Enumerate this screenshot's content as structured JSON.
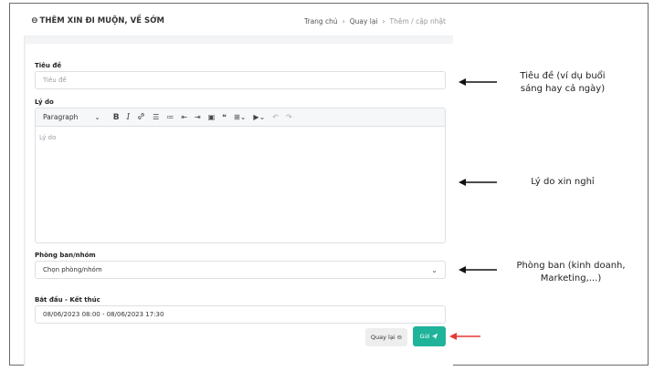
{
  "header": {
    "title": "THÊM XIN ĐI MUỘN, VỀ SỚM",
    "back_icon": "circle-arrow-left-icon",
    "breadcrumb": [
      "Trang chủ",
      "Quay lại",
      "Thêm / cập nhật"
    ],
    "separator": "›"
  },
  "form": {
    "title_field": {
      "label": "Tiêu đề",
      "placeholder": "Tiêu đề",
      "value": ""
    },
    "reason_field": {
      "label": "Lý do",
      "placeholder": "Lý do",
      "toolbar": {
        "paragraph": "Paragraph",
        "chevron": "⌄",
        "bold": "B",
        "italic": "I",
        "link": "🔗",
        "bullet_list": "☰",
        "numbered_list": "≔",
        "outdent": "⇤",
        "indent": "⇥",
        "image": "▣",
        "quote": "❝",
        "table": "⊞",
        "media": "▶",
        "undo": "↶",
        "redo": "↷"
      }
    },
    "department_field": {
      "label": "Phòng ban/nhóm",
      "placeholder": "Chọn phòng/nhóm"
    },
    "time_field": {
      "label": "Bắt đầu - Kết thúc",
      "value": "08/06/2023 08:00 - 08/06/2023 17:30"
    },
    "back_button": "Quay lại",
    "send_button": "Gửi"
  },
  "annotations": {
    "title_note": [
      "Tiêu đề (ví dụ buổi",
      "sáng hay cả ngày)"
    ],
    "reason_note": "Lý do xin nghỉ",
    "department_note": [
      "Phòng ban (kinh doanh,",
      "Marketing,...)"
    ]
  },
  "colors": {
    "accent": "#1fb39a",
    "arrow_red": "#e53935"
  }
}
